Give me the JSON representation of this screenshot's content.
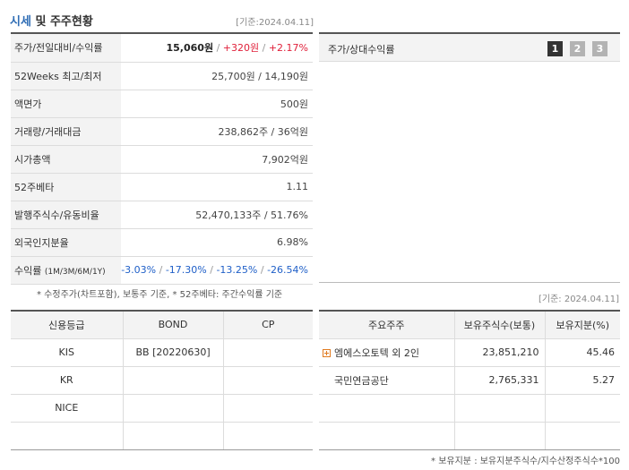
{
  "header": {
    "title_part1": "시세",
    "title_part2": "및 주주현황",
    "date": "[기준:2024.04.11]"
  },
  "price_rows": [
    {
      "label": "주가/전일대비/수익률",
      "price": "15,060원",
      "change": "+320원",
      "rate": "+2.17%"
    },
    {
      "label": "52Weeks 최고/최저",
      "value": "25,700원 / 14,190원"
    },
    {
      "label": "액면가",
      "value": "500원"
    },
    {
      "label": "거래량/거래대금",
      "value": "238,862주 / 36억원"
    },
    {
      "label": "시가총액",
      "value": "7,902억원"
    },
    {
      "label": "52주베타",
      "value": "1.11"
    },
    {
      "label": "발행주식수/유동비율",
      "value": "52,470,133주 / 51.76%"
    },
    {
      "label": "외국인지분율",
      "value": "6.98%"
    },
    {
      "label": "수익률",
      "label_sub": "(1M/3M/6M/1Y)",
      "returns": [
        "-3.03%",
        "-17.30%",
        "-13.25%",
        "-26.54%"
      ]
    }
  ],
  "note_left": "* 수정주가(차트포함), 보통주 기준, * 52주베타: 주간수익률 기준",
  "chart_panel": {
    "label": "주가/상대수익률",
    "buttons": [
      "1",
      "2",
      "3"
    ],
    "active_button": "1"
  },
  "date_right": "[기준: 2024.04.11]",
  "credit_table": {
    "headers": [
      "신용등급",
      "BOND",
      "CP"
    ],
    "rows": [
      [
        "KIS",
        "BB   [20220630]",
        ""
      ],
      [
        "KR",
        "",
        ""
      ],
      [
        "NICE",
        "",
        ""
      ],
      [
        "",
        "",
        ""
      ]
    ]
  },
  "holders_table": {
    "headers": [
      "주요주주",
      "보유주식수(보통)",
      "보유지분(%)"
    ],
    "rows": [
      [
        "엠에스오토텍 외 2인",
        "23,851,210",
        "45.46"
      ],
      [
        "국민연금공단",
        "2,765,331",
        "5.27"
      ],
      [
        "",
        "",
        ""
      ],
      [
        "",
        "",
        ""
      ]
    ]
  },
  "note_right": "* 보유지분 : 보유지분주식수/지수산정주식수*100",
  "colors": {
    "up": "#e0203a",
    "down": "#2060c8",
    "accent": "#2f6db5"
  },
  "icons": [
    "plus-icon"
  ]
}
